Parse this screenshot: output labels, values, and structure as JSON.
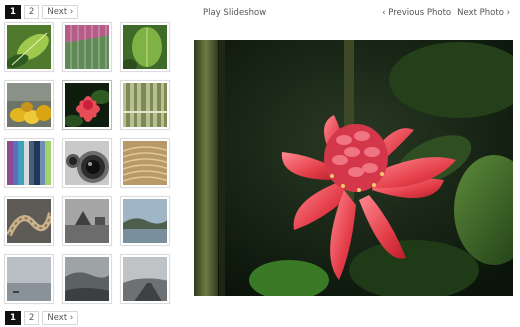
{
  "pagination_top": {
    "pages": [
      "1",
      "2"
    ],
    "current": "1",
    "next_label": "Next ›"
  },
  "pagination_bottom": {
    "pages": [
      "1",
      "2"
    ],
    "current": "1",
    "next_label": "Next ›"
  },
  "controls": {
    "play_slideshow": "Play Slideshow",
    "previous_photo": "‹ Previous Photo",
    "next_photo": "Next Photo ›"
  },
  "thumbnails": [
    {
      "name": "green-leaves-thumbnail"
    },
    {
      "name": "pink-rain-leaf-thumbnail"
    },
    {
      "name": "green-leaf-thumbnail"
    },
    {
      "name": "yellow-fruits-thumbnail"
    },
    {
      "name": "red-flower-thumbnail",
      "selected": true
    },
    {
      "name": "bamboo-thumbnail"
    },
    {
      "name": "colored-stripes-thumbnail"
    },
    {
      "name": "camera-lens-thumbnail"
    },
    {
      "name": "wooden-texture-thumbnail"
    },
    {
      "name": "rope-thumbnail"
    },
    {
      "name": "harbor-grey-thumbnail"
    },
    {
      "name": "coast-landscape-thumbnail"
    },
    {
      "name": "hazy-sea-thumbnail"
    },
    {
      "name": "misty-coast-thumbnail"
    },
    {
      "name": "road-landscape-thumbnail"
    }
  ],
  "colors": {
    "current_page_bg": "#111111",
    "border": "#d7d7d7",
    "text": "#555555"
  }
}
